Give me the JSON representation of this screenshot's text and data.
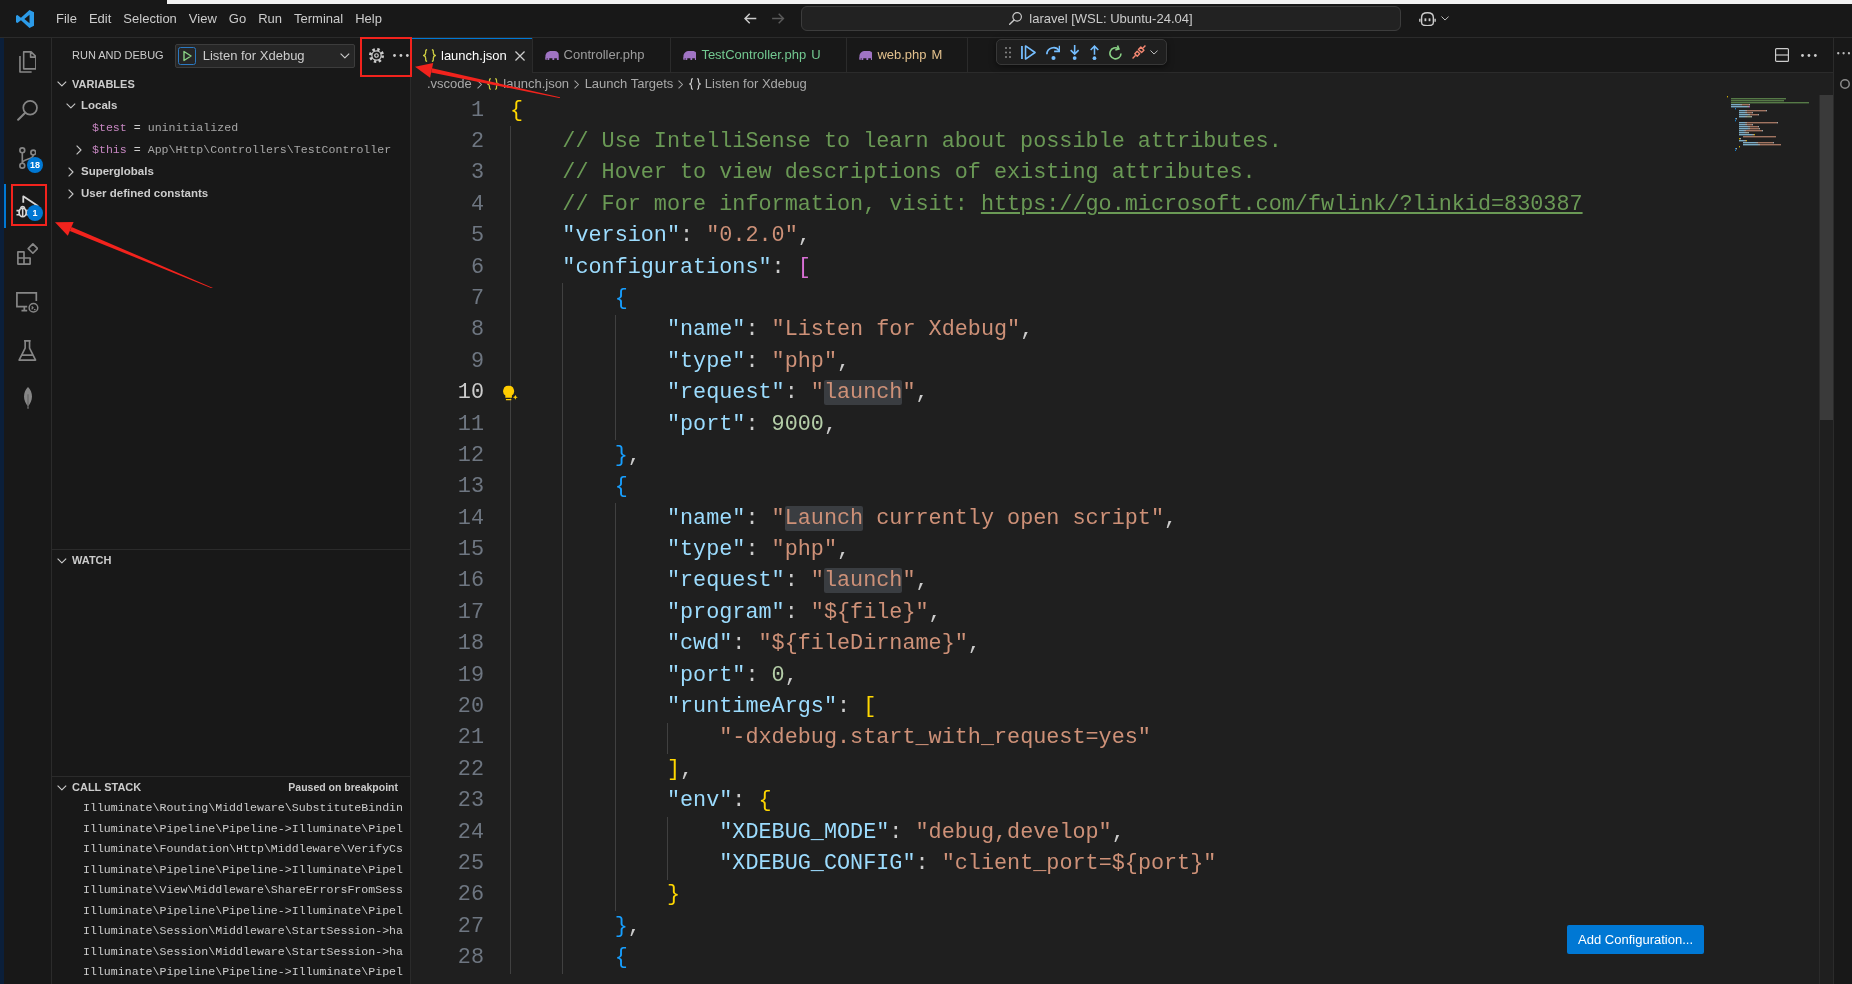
{
  "title_bar": {
    "menu": [
      "File",
      "Edit",
      "Selection",
      "View",
      "Go",
      "Run",
      "Terminal",
      "Help"
    ],
    "navigation": {
      "back_enabled": true,
      "forward_enabled": false
    },
    "search": "laravel [WSL: Ubuntu-24.04]"
  },
  "activity_bar": [
    {
      "kind": "files",
      "selected": false,
      "annotated": false
    },
    {
      "kind": "search",
      "selected": false,
      "annotated": false
    },
    {
      "kind": "source_control",
      "selected": false,
      "annotated": false,
      "badge": "18"
    },
    {
      "kind": "run_debug",
      "selected": true,
      "annotated": true,
      "badge": "1"
    },
    {
      "kind": "extensions",
      "selected": false,
      "annotated": false
    },
    {
      "kind": "remote",
      "selected": false,
      "annotated": false
    },
    {
      "kind": "testing",
      "selected": false,
      "annotated": false
    },
    {
      "kind": "leaf",
      "selected": false,
      "annotated": false
    }
  ],
  "sidebar": {
    "title": "RUN AND DEBUG",
    "configuration": "Listen for Xdebug",
    "actions_annotated": true,
    "sections": [
      {
        "kind": "variables",
        "title": "VARIABLES",
        "expanded": true,
        "tree": [
          {
            "label": "Locals",
            "expanded": true,
            "children": [
              {
                "name": "$test",
                "separator": " = ",
                "value": "uninitialized"
              },
              {
                "name": "$this",
                "separator": " = ",
                "value": "App\\Http\\Controllers\\TestController",
                "expanded": false
              }
            ]
          },
          {
            "label": "Superglobals",
            "expanded": false
          },
          {
            "label": "User defined constants",
            "expanded": false
          }
        ]
      },
      {
        "kind": "watch",
        "title": "WATCH",
        "expanded": true
      },
      {
        "kind": "call_stack",
        "title": "CALL STACK",
        "expanded": true,
        "status": "Paused on breakpoint",
        "frames": [
          "Illuminate\\Routing\\Middleware\\SubstituteBindin",
          "Illuminate\\Pipeline\\Pipeline->Illuminate\\Pipel",
          "Illuminate\\Foundation\\Http\\Middleware\\VerifyCs",
          "Illuminate\\Pipeline\\Pipeline->Illuminate\\Pipel",
          "Illuminate\\View\\Middleware\\ShareErrorsFromSess",
          "Illuminate\\Pipeline\\Pipeline->Illuminate\\Pipel",
          "Illuminate\\Session\\Middleware\\StartSession->ha",
          "Illuminate\\Session\\Middleware\\StartSession->ha",
          "Illuminate\\Pipeline\\Pipeline->Illuminate\\Pipel"
        ]
      }
    ]
  },
  "editor": {
    "tabs": [
      {
        "label": "launch.json",
        "kind": "json",
        "selected": true
      },
      {
        "label": "Controller.php",
        "kind": "php",
        "selected": false
      },
      {
        "label": "TestController.php",
        "kind": "php",
        "selected": false,
        "status": "U",
        "color": "#73c991"
      },
      {
        "label": "web.php",
        "kind": "php",
        "selected": false,
        "status": "M",
        "color": "#e2c08d"
      }
    ],
    "debug_toolbar": [
      {
        "kind": "continue"
      },
      {
        "kind": "step_over"
      },
      {
        "kind": "step_into"
      },
      {
        "kind": "step_out"
      },
      {
        "kind": "restart"
      },
      {
        "kind": "disconnect"
      }
    ],
    "breadcrumbs": [
      {
        "label": ".vscode",
        "kind": "folder"
      },
      {
        "label": "launch.json",
        "kind": "json"
      },
      {
        "label": "Launch Targets",
        "kind": "group"
      },
      {
        "label": "Listen for Xdebug",
        "kind": "object"
      }
    ],
    "lines": [
      {
        "number": "1",
        "current": false,
        "tokens": [
          {
            "kind": "open",
            "text": "{"
          }
        ]
      },
      {
        "number": "2",
        "current": false,
        "tokens": [
          {
            "kind": "comment",
            "text": "// Use IntelliSense to learn about possible attributes."
          }
        ]
      },
      {
        "number": "3",
        "current": false,
        "tokens": [
          {
            "kind": "comment",
            "text": "// Hover to view descriptions of existing attributes."
          }
        ]
      },
      {
        "number": "4",
        "current": false,
        "tokens": [
          {
            "kind": "comment",
            "text": "// For more information, visit: "
          },
          {
            "kind": "link",
            "text": "https://go.microsoft.com/fwlink/?linkid=830387"
          }
        ]
      },
      {
        "number": "5",
        "current": false,
        "tokens": [
          {
            "kind": "key",
            "text": "\"version\""
          },
          {
            "kind": "punct",
            "text": ": "
          },
          {
            "kind": "string",
            "text": "\"0.2.0\""
          },
          {
            "kind": "punct",
            "text": ","
          }
        ]
      },
      {
        "number": "6",
        "current": false,
        "tokens": [
          {
            "kind": "key",
            "text": "\"configurations\""
          },
          {
            "kind": "punct",
            "text": ": "
          },
          {
            "kind": "open",
            "text": "["
          }
        ]
      },
      {
        "number": "7",
        "current": false,
        "tokens": [
          {
            "kind": "open",
            "text": "{"
          }
        ]
      },
      {
        "number": "8",
        "current": false,
        "tokens": [
          {
            "kind": "key",
            "text": "\"name\""
          },
          {
            "kind": "punct",
            "text": ": "
          },
          {
            "kind": "string",
            "text": "\"Listen for Xdebug\""
          },
          {
            "kind": "punct",
            "text": ","
          }
        ]
      },
      {
        "number": "9",
        "current": false,
        "tokens": [
          {
            "kind": "key",
            "text": "\"type\""
          },
          {
            "kind": "punct",
            "text": ": "
          },
          {
            "kind": "string",
            "text": "\"php\""
          },
          {
            "kind": "punct",
            "text": ","
          }
        ]
      },
      {
        "number": "10",
        "current": true,
        "lightbulb": true,
        "tokens": [
          {
            "kind": "key",
            "text": "\"request\""
          },
          {
            "kind": "punct",
            "text": ": "
          },
          {
            "kind": "string",
            "text": "\""
          },
          {
            "kind": "string",
            "text": "launch",
            "highlight": true
          },
          {
            "kind": "string",
            "text": "\""
          },
          {
            "kind": "punct",
            "text": ","
          }
        ]
      },
      {
        "number": "11",
        "current": false,
        "tokens": [
          {
            "kind": "key",
            "text": "\"port\""
          },
          {
            "kind": "punct",
            "text": ": "
          },
          {
            "kind": "number",
            "text": "9000"
          },
          {
            "kind": "punct",
            "text": ","
          }
        ]
      },
      {
        "number": "12",
        "current": false,
        "tokens": [
          {
            "kind": "close",
            "text": "}"
          },
          {
            "kind": "punct",
            "text": ","
          }
        ]
      },
      {
        "number": "13",
        "current": false,
        "tokens": [
          {
            "kind": "open",
            "text": "{"
          }
        ]
      },
      {
        "number": "14",
        "current": false,
        "tokens": [
          {
            "kind": "key",
            "text": "\"name\""
          },
          {
            "kind": "punct",
            "text": ": "
          },
          {
            "kind": "string",
            "text": "\""
          },
          {
            "kind": "string",
            "text": "Launch",
            "highlight": true
          },
          {
            "kind": "string",
            "text": " currently open script\""
          },
          {
            "kind": "punct",
            "text": ","
          }
        ]
      },
      {
        "number": "15",
        "current": false,
        "tokens": [
          {
            "kind": "key",
            "text": "\"type\""
          },
          {
            "kind": "punct",
            "text": ": "
          },
          {
            "kind": "string",
            "text": "\"php\""
          },
          {
            "kind": "punct",
            "text": ","
          }
        ]
      },
      {
        "number": "16",
        "current": false,
        "tokens": [
          {
            "kind": "key",
            "text": "\"request\""
          },
          {
            "kind": "punct",
            "text": ": "
          },
          {
            "kind": "string",
            "text": "\""
          },
          {
            "kind": "string",
            "text": "launch",
            "highlight": true
          },
          {
            "kind": "string",
            "text": "\""
          },
          {
            "kind": "punct",
            "text": ","
          }
        ]
      },
      {
        "number": "17",
        "current": false,
        "tokens": [
          {
            "kind": "key",
            "text": "\"program\""
          },
          {
            "kind": "punct",
            "text": ": "
          },
          {
            "kind": "string",
            "text": "\"${file}\""
          },
          {
            "kind": "punct",
            "text": ","
          }
        ]
      },
      {
        "number": "18",
        "current": false,
        "tokens": [
          {
            "kind": "key",
            "text": "\"cwd\""
          },
          {
            "kind": "punct",
            "text": ": "
          },
          {
            "kind": "string",
            "text": "\"${fileDirname}\""
          },
          {
            "kind": "punct",
            "text": ","
          }
        ]
      },
      {
        "number": "19",
        "current": false,
        "tokens": [
          {
            "kind": "key",
            "text": "\"port\""
          },
          {
            "kind": "punct",
            "text": ": "
          },
          {
            "kind": "number",
            "text": "0"
          },
          {
            "kind": "punct",
            "text": ","
          }
        ]
      },
      {
        "number": "20",
        "current": false,
        "tokens": [
          {
            "kind": "key",
            "text": "\"runtimeArgs\""
          },
          {
            "kind": "punct",
            "text": ": "
          },
          {
            "kind": "open",
            "text": "["
          }
        ]
      },
      {
        "number": "21",
        "current": false,
        "tokens": [
          {
            "kind": "string",
            "text": "\"-dxdebug.start_with_request=yes\""
          }
        ]
      },
      {
        "number": "22",
        "current": false,
        "tokens": [
          {
            "kind": "close",
            "text": "]"
          },
          {
            "kind": "punct",
            "text": ","
          }
        ]
      },
      {
        "number": "23",
        "current": false,
        "tokens": [
          {
            "kind": "key",
            "text": "\"env\""
          },
          {
            "kind": "punct",
            "text": ": "
          },
          {
            "kind": "open",
            "text": "{"
          }
        ]
      },
      {
        "number": "24",
        "current": false,
        "tokens": [
          {
            "kind": "key",
            "text": "\"XDEBUG_MODE\""
          },
          {
            "kind": "punct",
            "text": ": "
          },
          {
            "kind": "string",
            "text": "\"debug,develop\""
          },
          {
            "kind": "punct",
            "text": ","
          }
        ]
      },
      {
        "number": "25",
        "current": false,
        "tokens": [
          {
            "kind": "key",
            "text": "\"XDEBUG_CONFIG\""
          },
          {
            "kind": "punct",
            "text": ": "
          },
          {
            "kind": "string",
            "text": "\"client_port=${port}\""
          }
        ]
      },
      {
        "number": "26",
        "current": false,
        "tokens": [
          {
            "kind": "close",
            "text": "}"
          }
        ]
      },
      {
        "number": "27",
        "current": false,
        "tokens": [
          {
            "kind": "close",
            "text": "}"
          },
          {
            "kind": "punct",
            "text": ","
          }
        ]
      },
      {
        "number": "28",
        "current": false,
        "tokens": [
          {
            "kind": "open",
            "text": "{"
          }
        ]
      }
    ],
    "add_configuration": "Add Configuration..."
  }
}
